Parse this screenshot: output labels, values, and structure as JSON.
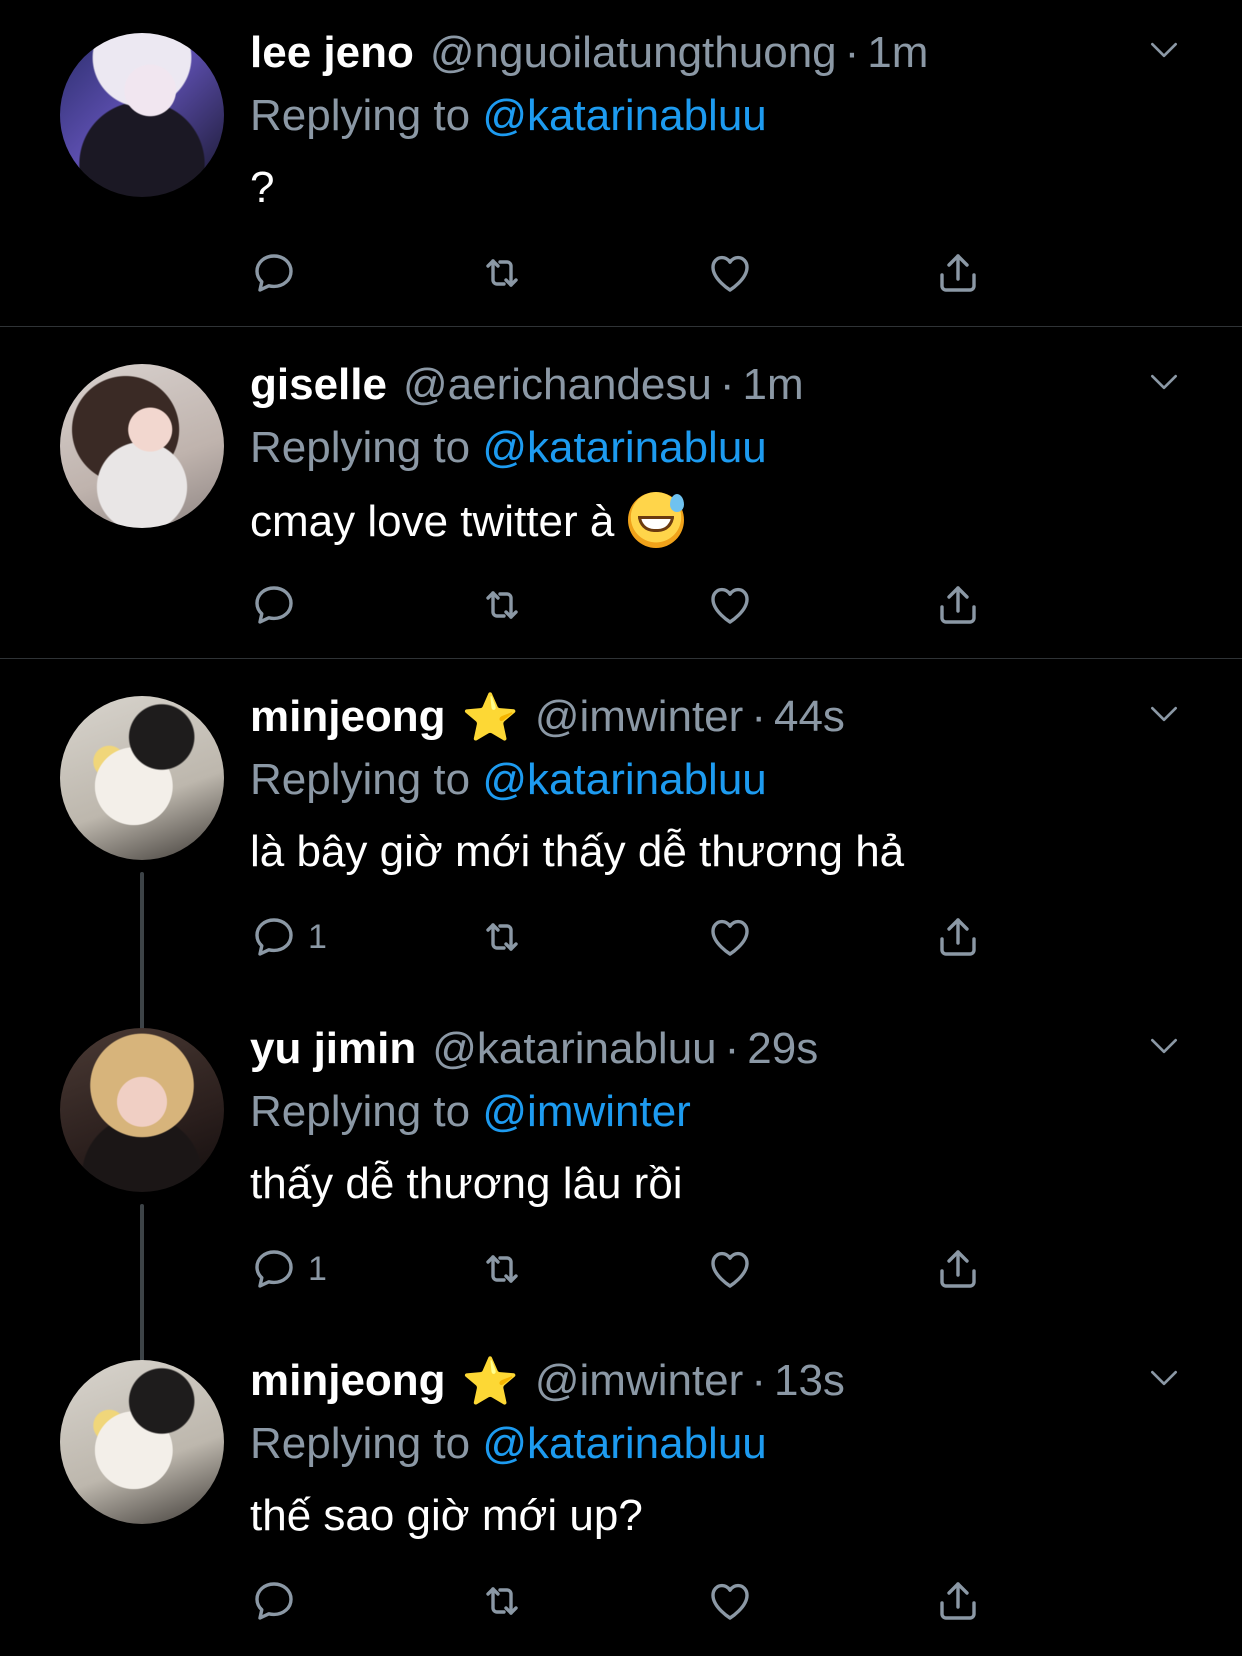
{
  "colors": {
    "background": "#000000",
    "text": "#ffffff",
    "secondary": "#8b98a5",
    "link": "#1d9bf0",
    "divider": "#2f3336"
  },
  "tweets": [
    {
      "name": "lee jeno",
      "verified_star": "",
      "handle": "@nguoilatungthuong",
      "time": "1m",
      "reply_prefix": "Replying to",
      "reply_to": "@katarinabluu",
      "text": "?",
      "reply_count": ""
    },
    {
      "name": "giselle",
      "verified_star": "",
      "handle": "@aerichandesu",
      "time": "1m",
      "reply_prefix": "Replying to",
      "reply_to": "@katarinabluu",
      "text": "cmay love twitter à",
      "emoji": "sweat-smile-emoji",
      "reply_count": ""
    },
    {
      "name": "minjeong",
      "verified_star": "⭐",
      "handle": "@imwinter",
      "time": "44s",
      "reply_prefix": "Replying to",
      "reply_to": "@katarinabluu",
      "text": "là bây giờ mới thấy dễ thương hả",
      "reply_count": "1"
    },
    {
      "name": "yu jimin",
      "verified_star": "",
      "handle": "@katarinabluu",
      "time": "29s",
      "reply_prefix": "Replying to",
      "reply_to": "@imwinter",
      "text": "thấy dễ thương lâu rồi",
      "reply_count": "1"
    },
    {
      "name": "minjeong",
      "verified_star": "⭐",
      "handle": "@imwinter",
      "time": "13s",
      "reply_prefix": "Replying to",
      "reply_to": "@katarinabluu",
      "text": "thế sao giờ mới up?",
      "reply_count": ""
    }
  ],
  "separator": "·",
  "icons": {
    "reply": "reply-icon",
    "retweet": "retweet-icon",
    "like": "heart-icon",
    "share": "share-icon",
    "menu": "chevron-down-icon"
  }
}
